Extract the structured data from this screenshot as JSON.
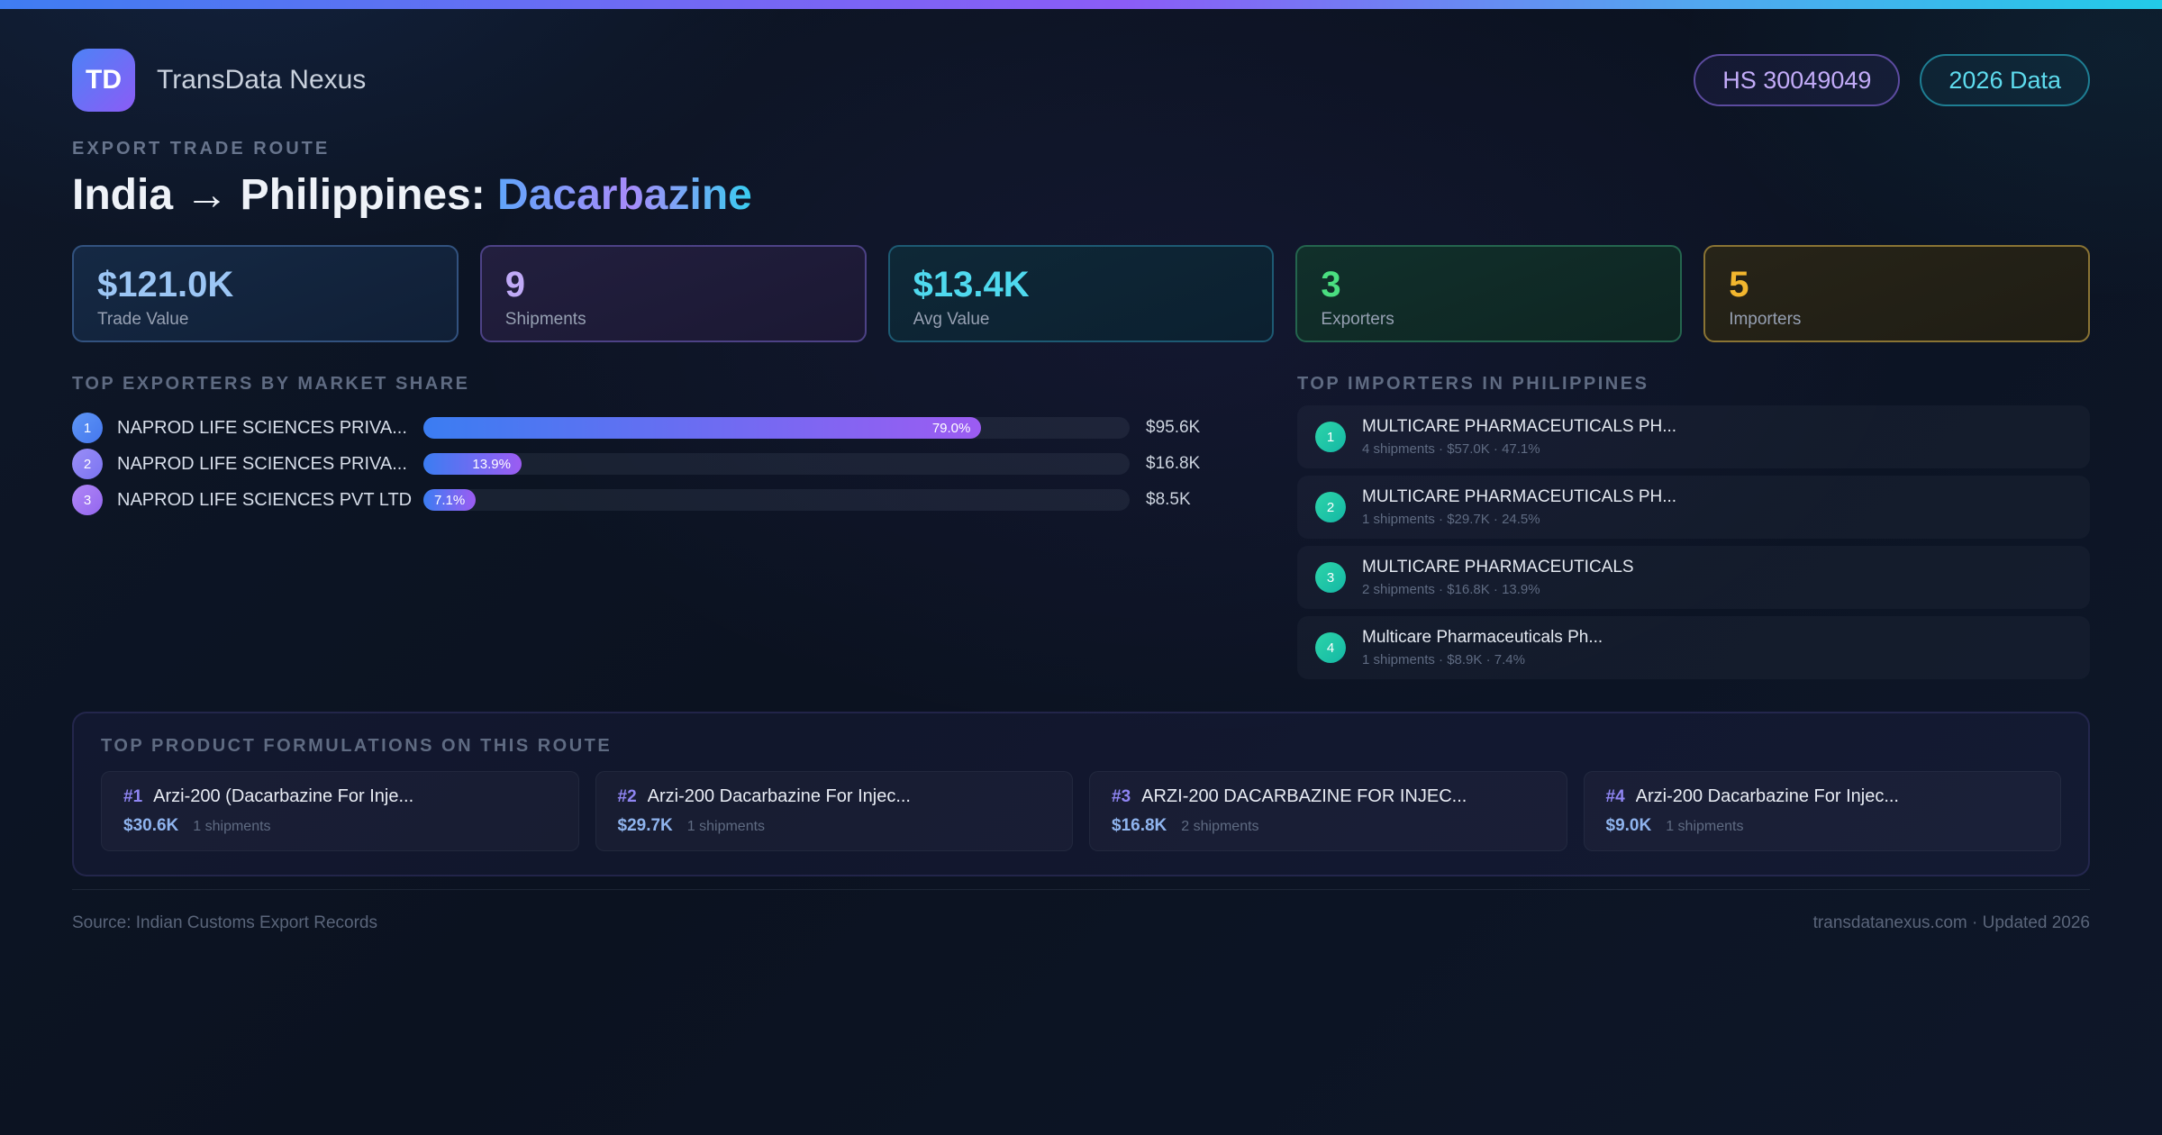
{
  "app": {
    "logo_text": "TD",
    "title": "TransData Nexus",
    "hs_badge": "HS 30049049",
    "year_badge": "2026 Data"
  },
  "hero": {
    "eyebrow": "EXPORT TRADE ROUTE",
    "route": "India → Philippines:",
    "product": "Dacarbazine"
  },
  "stats": [
    {
      "value": "$121.0K",
      "label": "Trade Value"
    },
    {
      "value": "9",
      "label": "Shipments"
    },
    {
      "value": "$13.4K",
      "label": "Avg Value"
    },
    {
      "value": "3",
      "label": "Exporters"
    },
    {
      "value": "5",
      "label": "Importers"
    }
  ],
  "exporters": {
    "heading": "TOP EXPORTERS BY MARKET SHARE",
    "items": [
      {
        "rank": "1",
        "name": "NAPROD LIFE SCIENCES PRIVA...",
        "share_pct": 79.0,
        "share_label": "79.0%",
        "value": "$95.6K"
      },
      {
        "rank": "2",
        "name": "NAPROD LIFE SCIENCES PRIVA...",
        "share_pct": 13.9,
        "share_label": "13.9%",
        "value": "$16.8K"
      },
      {
        "rank": "3",
        "name": "NAPROD LIFE SCIENCES PVT LTD",
        "share_pct": 7.1,
        "share_label": "7.1%",
        "value": "$8.5K"
      }
    ]
  },
  "importers": {
    "heading": "TOP IMPORTERS IN PHILIPPINES",
    "items": [
      {
        "rank": "1",
        "name": "MULTICARE PHARMACEUTICALS PH...",
        "meta": "4 shipments · $57.0K · 47.1%"
      },
      {
        "rank": "2",
        "name": "MULTICARE PHARMACEUTICALS PH...",
        "meta": "1 shipments · $29.7K · 24.5%"
      },
      {
        "rank": "3",
        "name": "MULTICARE PHARMACEUTICALS",
        "meta": "2 shipments · $16.8K · 13.9%"
      },
      {
        "rank": "4",
        "name": "Multicare Pharmaceuticals Ph...",
        "meta": "1 shipments · $8.9K · 7.4%"
      }
    ]
  },
  "products": {
    "heading": "TOP PRODUCT FORMULATIONS ON THIS ROUTE",
    "items": [
      {
        "rank": "#1",
        "name": "Arzi-200 (Dacarbazine For Inje...",
        "value": "$30.6K",
        "shipments": "1 shipments"
      },
      {
        "rank": "#2",
        "name": "Arzi-200 Dacarbazine For Injec...",
        "value": "$29.7K",
        "shipments": "1 shipments"
      },
      {
        "rank": "#3",
        "name": "ARZI-200 DACARBAZINE FOR INJEC...",
        "value": "$16.8K",
        "shipments": "2 shipments"
      },
      {
        "rank": "#4",
        "name": "Arzi-200 Dacarbazine For Injec...",
        "value": "$9.0K",
        "shipments": "1 shipments"
      }
    ]
  },
  "footer": {
    "source": "Source: Indian Customs Export Records",
    "site": "transdatanexus.com · Updated 2026"
  },
  "colors": {
    "accent_blue": "#3b82f6",
    "accent_purple": "#8b5cf6",
    "accent_cyan": "#22d3ee",
    "accent_green": "#4ade80",
    "accent_amber": "#f2b62e",
    "accent_teal": "#14b8a6"
  }
}
